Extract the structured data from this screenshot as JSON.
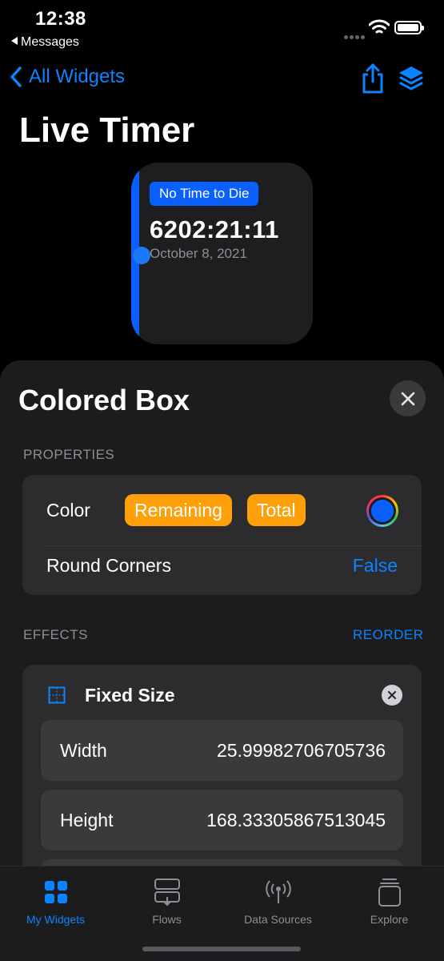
{
  "status": {
    "time": "12:38",
    "back_app": "Messages"
  },
  "nav": {
    "back_label": "All Widgets",
    "share_icon": "share-icon",
    "layers_icon": "layers-icon"
  },
  "page": {
    "title": "Live Timer"
  },
  "widget": {
    "tag": "No Time to Die",
    "timer": "6202:21:11",
    "date": "October 8, 2021",
    "accent": "#0a60ff"
  },
  "sheet": {
    "title": "Colored Box",
    "properties_header": "PROPERTIES",
    "color_label": "Color",
    "color_pills": [
      "Remaining",
      "Total"
    ],
    "swatch_color": "#0a60ff",
    "round_corners_label": "Round Corners",
    "round_corners_value": "False",
    "effects_header": "EFFECTS",
    "reorder_label": "REORDER",
    "effect": {
      "title": "Fixed Size",
      "width_label": "Width",
      "width_value": "25.99982706705736",
      "height_label": "Height",
      "height_value": "168.33305867513045"
    }
  },
  "tabs": [
    {
      "label": "My Widgets",
      "icon": "grid-icon"
    },
    {
      "label": "Flows",
      "icon": "flows-icon"
    },
    {
      "label": "Data Sources",
      "icon": "antenna-icon"
    },
    {
      "label": "Explore",
      "icon": "stack-icon"
    }
  ],
  "colors": {
    "accent": "#0a84ff",
    "pill": "#ff9f0a",
    "background": "#000000",
    "sheet": "#1c1c1e"
  }
}
